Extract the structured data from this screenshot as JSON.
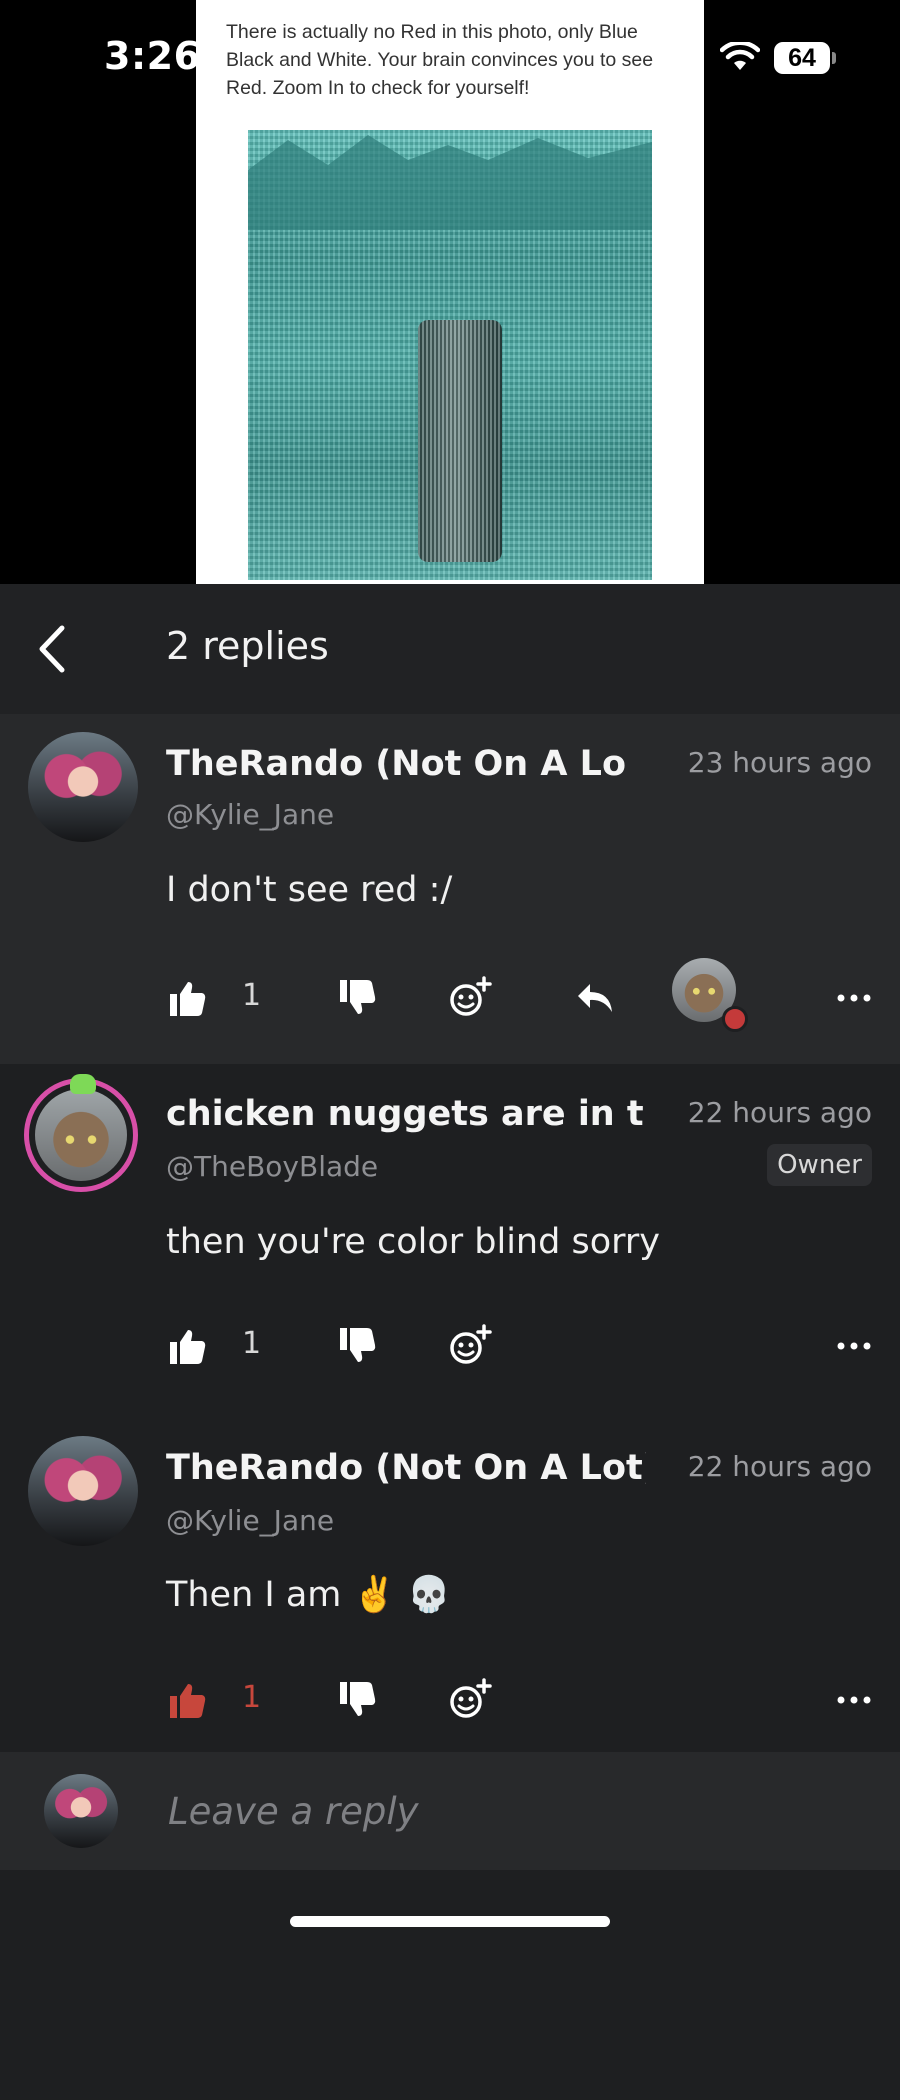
{
  "status_bar": {
    "time": "3:26",
    "battery": "64"
  },
  "media": {
    "caption": "There is actually no Red in this photo, only Blue Black and White. Your brain convinces you to see Red. Zoom In to check for yourself!"
  },
  "header": {
    "title": "2 replies"
  },
  "comments": [
    {
      "name": "TheRando (Not On A Lot)",
      "handle": "@Kylie_Jane",
      "ago": "23 hours ago",
      "text": "I don't see red :/",
      "likes": "1"
    },
    {
      "name": "chicken nuggets are in the",
      "handle": "@TheBoyBlade",
      "ago": "22 hours ago",
      "badge": "Owner",
      "text": "then you're color blind sorry",
      "likes": "1"
    },
    {
      "name": "TheRando (Not On A Lot)",
      "handle": "@Kylie_Jane",
      "ago": "22 hours ago",
      "text": "Then I am ✌️ 💀",
      "likes": "1"
    }
  ],
  "reply": {
    "placeholder": "Leave a reply"
  },
  "colors": {
    "liked": "#c7473c",
    "panel": "#28292b",
    "bg": "#1e1f21"
  }
}
